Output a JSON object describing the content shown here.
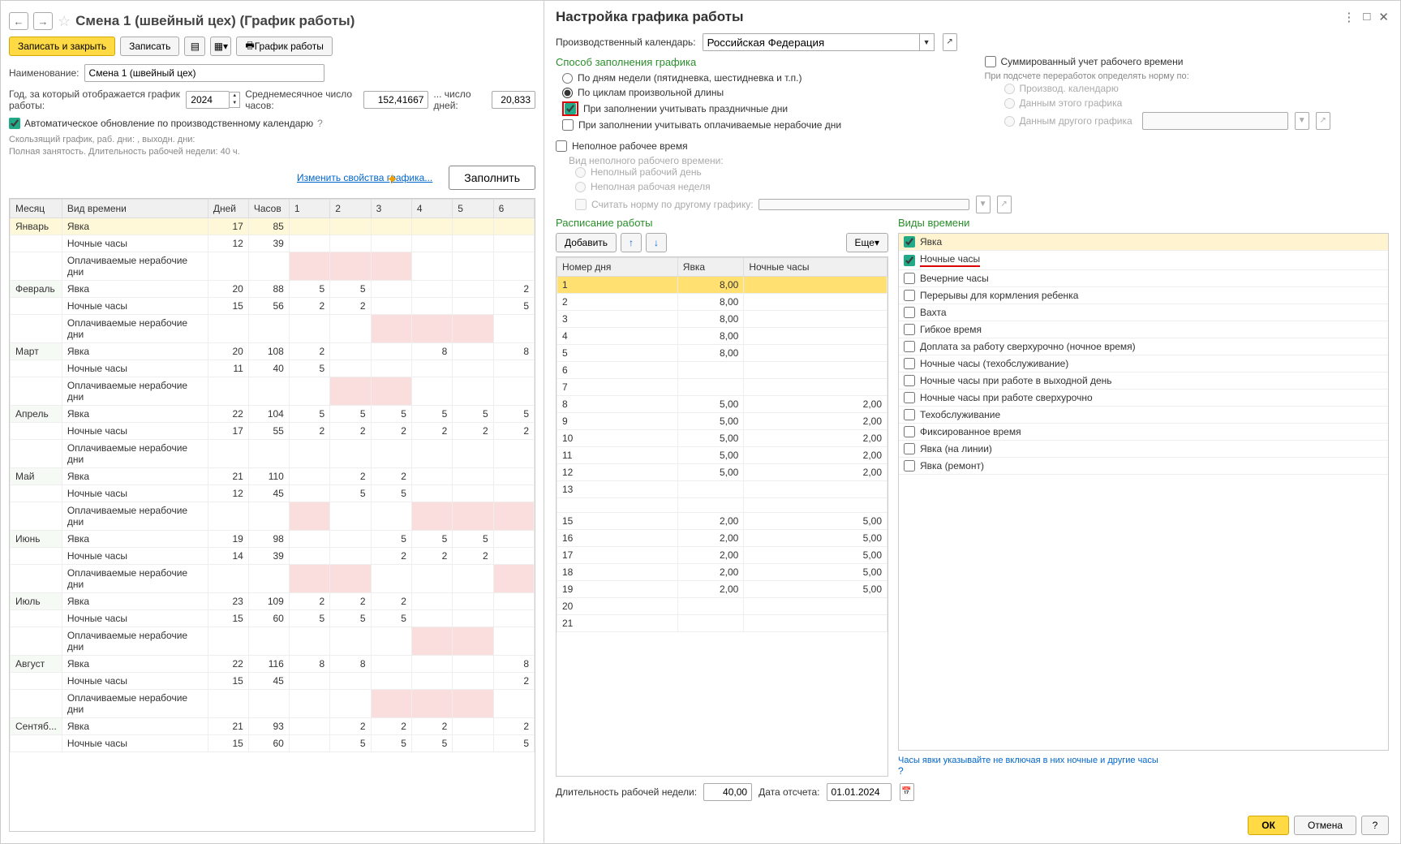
{
  "left": {
    "title": "Смена 1 (швейный цех) (График работы)",
    "toolbar": {
      "save_close": "Записать и закрыть",
      "save": "Записать",
      "print_schedule": "График работы"
    },
    "name_label": "Наименование:",
    "name_value": "Смена 1 (швейный цех)",
    "year_label": "Год, за который отображается график работы:",
    "year_value": "2024",
    "avg_hours_label": "Среднемесячное число часов:",
    "avg_hours_value": "152,41667",
    "avg_days_label": "... число дней:",
    "avg_days_value": "20,833",
    "auto_update": "Автоматическое обновление по производственному календарю",
    "info1": "Скользящий график, раб. дни: , выходн. дни:",
    "info2": "Полная занятость. Длительность рабочей недели: 40 ч.",
    "change_props": "Изменить свойства графика...",
    "fill_btn": "Заполнить",
    "table_headers": [
      "Месяц",
      "Вид времени",
      "Дней",
      "Часов",
      "1",
      "2",
      "3",
      "4",
      "5",
      "6"
    ],
    "rows": [
      {
        "m": "Январь",
        "t": "Явка",
        "d": "17",
        "h": "85",
        "c": [
          "",
          "",
          "",
          "",
          "",
          ""
        ],
        "yellow": true
      },
      {
        "m": "",
        "t": "Ночные часы",
        "d": "12",
        "h": "39",
        "c": [
          "",
          "",
          "",
          "",
          "",
          ""
        ]
      },
      {
        "m": "",
        "t": "Оплачиваемые нерабочие дни",
        "d": "",
        "h": "",
        "c": [
          "",
          "",
          "",
          "",
          "",
          ""
        ],
        "pink": [
          0,
          1,
          2
        ]
      },
      {
        "m": "Февраль",
        "t": "Явка",
        "d": "20",
        "h": "88",
        "c": [
          "5",
          "5",
          "",
          "",
          "",
          "2"
        ]
      },
      {
        "m": "",
        "t": "Ночные часы",
        "d": "15",
        "h": "56",
        "c": [
          "2",
          "2",
          "",
          "",
          "",
          "5"
        ]
      },
      {
        "m": "",
        "t": "Оплачиваемые нерабочие дни",
        "d": "",
        "h": "",
        "c": [
          "",
          "",
          "",
          "",
          "",
          ""
        ],
        "pink": [
          2,
          3,
          4
        ]
      },
      {
        "m": "Март",
        "t": "Явка",
        "d": "20",
        "h": "108",
        "c": [
          "2",
          "",
          "",
          "8",
          "",
          "8"
        ]
      },
      {
        "m": "",
        "t": "Ночные часы",
        "d": "11",
        "h": "40",
        "c": [
          "5",
          "",
          "",
          "",
          "",
          ""
        ]
      },
      {
        "m": "",
        "t": "Оплачиваемые нерабочие дни",
        "d": "",
        "h": "",
        "c": [
          "",
          "",
          "",
          "",
          "",
          ""
        ],
        "pink": [
          1,
          2
        ]
      },
      {
        "m": "Апрель",
        "t": "Явка",
        "d": "22",
        "h": "104",
        "c": [
          "5",
          "5",
          "5",
          "5",
          "5",
          "5"
        ]
      },
      {
        "m": "",
        "t": "Ночные часы",
        "d": "17",
        "h": "55",
        "c": [
          "2",
          "2",
          "2",
          "2",
          "2",
          "2"
        ]
      },
      {
        "m": "",
        "t": "Оплачиваемые нерабочие дни",
        "d": "",
        "h": "",
        "c": [
          "",
          "",
          "",
          "",
          "",
          ""
        ]
      },
      {
        "m": "Май",
        "t": "Явка",
        "d": "21",
        "h": "110",
        "c": [
          "",
          "2",
          "2",
          "",
          "",
          ""
        ]
      },
      {
        "m": "",
        "t": "Ночные часы",
        "d": "12",
        "h": "45",
        "c": [
          "",
          "5",
          "5",
          "",
          "",
          ""
        ]
      },
      {
        "m": "",
        "t": "Оплачиваемые нерабочие дни",
        "d": "",
        "h": "",
        "c": [
          "",
          "",
          "",
          "",
          "",
          ""
        ],
        "pink": [
          0,
          3,
          4,
          5
        ]
      },
      {
        "m": "Июнь",
        "t": "Явка",
        "d": "19",
        "h": "98",
        "c": [
          "",
          "",
          "5",
          "5",
          "5",
          ""
        ]
      },
      {
        "m": "",
        "t": "Ночные часы",
        "d": "14",
        "h": "39",
        "c": [
          "",
          "",
          "2",
          "2",
          "2",
          ""
        ]
      },
      {
        "m": "",
        "t": "Оплачиваемые нерабочие дни",
        "d": "",
        "h": "",
        "c": [
          "",
          "",
          "",
          "",
          "",
          ""
        ],
        "pink": [
          0,
          1,
          5
        ]
      },
      {
        "m": "Июль",
        "t": "Явка",
        "d": "23",
        "h": "109",
        "c": [
          "2",
          "2",
          "2",
          "",
          "",
          ""
        ]
      },
      {
        "m": "",
        "t": "Ночные часы",
        "d": "15",
        "h": "60",
        "c": [
          "5",
          "5",
          "5",
          "",
          "",
          ""
        ]
      },
      {
        "m": "",
        "t": "Оплачиваемые нерабочие дни",
        "d": "",
        "h": "",
        "c": [
          "",
          "",
          "",
          "",
          "",
          ""
        ],
        "pink": [
          3,
          4
        ]
      },
      {
        "m": "Август",
        "t": "Явка",
        "d": "22",
        "h": "116",
        "c": [
          "8",
          "8",
          "",
          "",
          "",
          "8"
        ]
      },
      {
        "m": "",
        "t": "Ночные часы",
        "d": "15",
        "h": "45",
        "c": [
          "",
          "",
          "",
          "",
          "",
          "2"
        ]
      },
      {
        "m": "",
        "t": "Оплачиваемые нерабочие дни",
        "d": "",
        "h": "",
        "c": [
          "",
          "",
          "",
          "",
          "",
          ""
        ],
        "pink": [
          2,
          3,
          4
        ]
      },
      {
        "m": "Сентяб...",
        "t": "Явка",
        "d": "21",
        "h": "93",
        "c": [
          "",
          "2",
          "2",
          "2",
          "",
          "2"
        ]
      },
      {
        "m": "",
        "t": "Ночные часы",
        "d": "15",
        "h": "60",
        "c": [
          "",
          "5",
          "5",
          "5",
          "",
          "5"
        ]
      }
    ]
  },
  "right": {
    "title": "Настройка графика работы",
    "cal_label": "Производственный календарь:",
    "cal_value": "Российская Федерация",
    "method_head": "Способ заполнения графика",
    "method_opt1": "По дням недели (пятидневка, шестидневка и т.п.)",
    "method_opt2": "По циклам произвольной длины",
    "cb_holidays": "При заполнении учитывать праздничные дни",
    "cb_paid_nonwork": "При заполнении учитывать оплачиваемые нерабочие дни",
    "cb_summary": "Суммированный учет рабочего времени",
    "norm_label": "При подсчете переработок определять норму по:",
    "norm_opt1": "Производ. календарю",
    "norm_opt2": "Данным этого графика",
    "norm_opt3": "Данным другого графика",
    "cb_parttime": "Неполное рабочее время",
    "pt_label": "Вид неполного рабочего времени:",
    "pt_opt1": "Неполный рабочий день",
    "pt_opt2": "Неполная рабочая неделя",
    "cb_other_norm": "Считать норму по другому графику:",
    "sched_head": "Расписание работы",
    "add_btn": "Добавить",
    "more_btn": "Еще",
    "sched_cols": [
      "Номер дня",
      "Явка",
      "Ночные часы"
    ],
    "sched_rows": [
      {
        "n": "1",
        "a": "8,00",
        "nc": ""
      },
      {
        "n": "2",
        "a": "8,00",
        "nc": ""
      },
      {
        "n": "3",
        "a": "8,00",
        "nc": ""
      },
      {
        "n": "4",
        "a": "8,00",
        "nc": ""
      },
      {
        "n": "5",
        "a": "8,00",
        "nc": ""
      },
      {
        "n": "6",
        "a": "",
        "nc": ""
      },
      {
        "n": "7",
        "a": "",
        "nc": ""
      },
      {
        "n": "8",
        "a": "5,00",
        "nc": "2,00"
      },
      {
        "n": "9",
        "a": "5,00",
        "nc": "2,00"
      },
      {
        "n": "10",
        "a": "5,00",
        "nc": "2,00"
      },
      {
        "n": "11",
        "a": "5,00",
        "nc": "2,00"
      },
      {
        "n": "12",
        "a": "5,00",
        "nc": "2,00"
      },
      {
        "n": "13",
        "a": "",
        "nc": ""
      },
      {
        "n": "",
        "a": "",
        "nc": ""
      },
      {
        "n": "15",
        "a": "2,00",
        "nc": "5,00"
      },
      {
        "n": "16",
        "a": "2,00",
        "nc": "5,00"
      },
      {
        "n": "17",
        "a": "2,00",
        "nc": "5,00"
      },
      {
        "n": "18",
        "a": "2,00",
        "nc": "5,00"
      },
      {
        "n": "19",
        "a": "2,00",
        "nc": "5,00"
      },
      {
        "n": "20",
        "a": "",
        "nc": ""
      },
      {
        "n": "21",
        "a": "",
        "nc": ""
      }
    ],
    "types_head": "Виды времени",
    "types": [
      {
        "label": "Явка",
        "checked": true,
        "hl": true
      },
      {
        "label": "Ночные часы",
        "checked": true,
        "underline": true
      },
      {
        "label": "Вечерние часы",
        "checked": false
      },
      {
        "label": "Перерывы для кормления ребенка",
        "checked": false
      },
      {
        "label": "Вахта",
        "checked": false
      },
      {
        "label": "Гибкое время",
        "checked": false
      },
      {
        "label": "Доплата за работу сверхурочно (ночное время)",
        "checked": false
      },
      {
        "label": "Ночные часы (техобслуживание)",
        "checked": false
      },
      {
        "label": "Ночные часы при работе в выходной день",
        "checked": false
      },
      {
        "label": "Ночные часы при работе сверхурочно",
        "checked": false
      },
      {
        "label": "Техобслуживание",
        "checked": false
      },
      {
        "label": "Фиксированное время",
        "checked": false
      },
      {
        "label": "Явка (на линии)",
        "checked": false
      },
      {
        "label": "Явка (ремонт)",
        "checked": false
      }
    ],
    "hint": "Часы явки указывайте не включая в них ночные и другие часы",
    "week_len_label": "Длительность рабочей недели:",
    "week_len_value": "40,00",
    "ref_date_label": "Дата отсчета:",
    "ref_date_value": "01.01.2024",
    "ok": "ОК",
    "cancel": "Отмена"
  }
}
